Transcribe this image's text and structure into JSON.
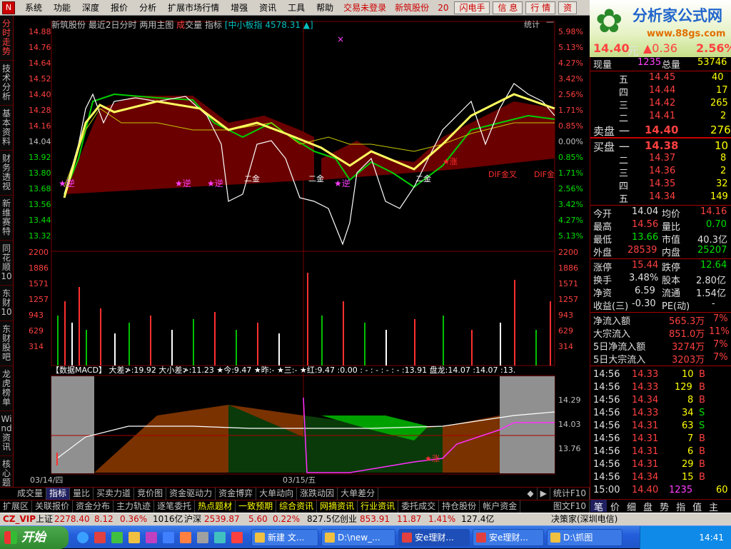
{
  "app": {
    "icon_label": "N"
  },
  "menu": {
    "items": [
      "系统",
      "功能",
      "深度",
      "报价",
      "分析",
      "扩展市场行情",
      "增强",
      "资讯",
      "工具",
      "帮助"
    ],
    "trade_not_logged": "交易未登录",
    "stock_link": "新筑股份",
    "year_fragment": "20",
    "buttons": [
      "闪电手",
      "信 息",
      "行 情",
      "资"
    ]
  },
  "logo": {
    "title": "分析家公式网",
    "url": "www.88gs.com"
  },
  "left_tabs": [
    "分时走势",
    "技术分析",
    "基本资料",
    "财务透视",
    "新维赛特",
    "同花顺10",
    "东财10",
    "东财股吧",
    "龙虎榜单",
    "Wind资讯",
    "核心题材"
  ],
  "chart_header": {
    "stock": "新筑股份",
    "period": "最近2日分时",
    "main": "两用主图",
    "vol_a": "成",
    "vol_b": "交量",
    "indicator": "指标",
    "index": "[中小板指 4578.31 ▲]",
    "stats_label": "统计",
    "minus": "—"
  },
  "price_axis": {
    "left": [
      "14.88",
      "14.76",
      "14.64",
      "14.52",
      "14.40",
      "14.28",
      "14.16",
      "14.04",
      "13.92",
      "13.80",
      "13.68",
      "13.56",
      "13.44",
      "13.32"
    ],
    "right": [
      "5.98%",
      "5.13%",
      "4.27%",
      "3.42%",
      "2.56%",
      "1.71%",
      "0.85%",
      "0.00%",
      "0.85%",
      "1.71%",
      "2.56%",
      "3.42%",
      "4.27%",
      "5.13%"
    ]
  },
  "vol_axis": {
    "values": [
      "2200",
      "1886",
      "1571",
      "1257",
      "943",
      "629",
      "314"
    ]
  },
  "lower_axis": {
    "values": [
      "14.29",
      "14.03",
      "13.76"
    ]
  },
  "chart_marks": {
    "nijun": "★逆",
    "ermjin": "二金",
    "dif_cross": "DIF金叉",
    "dif_gold": "DIF金",
    "zhang": "★涨",
    "star_x": "×"
  },
  "macd_header": {
    "name": "【数据MACD】",
    "items": [
      "大差≯:19.92",
      "大小差≯:11.23",
      "★今:9.47",
      "★昨:-",
      "★三:-",
      "★红:9.47",
      ":0.00",
      ": - : - : - : - :13.91",
      "盘龙:14.07",
      ":14.07",
      ":13."
    ]
  },
  "date_labels": [
    "03/14/四",
    "03/15/五"
  ],
  "bottom_tabs_1": [
    "成交量",
    "指标",
    "量比",
    "买卖力道",
    "竞价图",
    "资金驱动力",
    "资金博弈",
    "大单动向",
    "涨跌动因",
    "大单差分"
  ],
  "bottom_tabs_1_right": [
    "◆",
    "▶",
    "统计F10"
  ],
  "bottom_tabs_2": [
    "扩展区",
    "关联报价",
    "资金分布",
    "主力轨迹",
    "逐笔委托",
    "热点题材",
    "一致预期",
    "综合资讯",
    "网摘资讯",
    "行业资讯",
    "委托成交",
    "持仓股份",
    "帐户资金"
  ],
  "bottom_tabs_2_right": [
    "图文F10"
  ],
  "quote": {
    "price": "14.40",
    "unit": "元",
    "change": "▲0.36",
    "pct": "2.56%",
    "now_vol_label": "现量",
    "now_vol": "1235",
    "total_vol_label": "总量",
    "total_vol": "53746",
    "sell": [
      {
        "label": "五",
        "price": "14.45",
        "vol": "40"
      },
      {
        "label": "四",
        "price": "14.44",
        "vol": "17"
      },
      {
        "label": "三",
        "price": "14.42",
        "vol": "265"
      },
      {
        "label": "二",
        "price": "14.41",
        "vol": "2"
      },
      {
        "label": "一",
        "price": "14.40",
        "vol": "276"
      }
    ],
    "sell_label": "卖盘",
    "buy_label": "买盘",
    "buy": [
      {
        "label": "一",
        "price": "14.38",
        "vol": "10"
      },
      {
        "label": "二",
        "price": "14.37",
        "vol": "8"
      },
      {
        "label": "三",
        "price": "14.36",
        "vol": "2"
      },
      {
        "label": "四",
        "price": "14.35",
        "vol": "32"
      },
      {
        "label": "五",
        "price": "14.34",
        "vol": "149"
      }
    ],
    "stats": [
      {
        "l1": "今开",
        "v1": "14.04",
        "l2": "均价",
        "v2": "14.16"
      },
      {
        "l1": "最高",
        "v1": "14.56",
        "l2": "量比",
        "v2": "0.70"
      },
      {
        "l1": "最低",
        "v1": "13.66",
        "l2": "市值",
        "v2": "40.3亿"
      },
      {
        "l1": "外盘",
        "v1": "28539",
        "l2": "内盘",
        "v2": "25207"
      },
      {
        "l1": "涨停",
        "v1": "15.44",
        "l2": "跌停",
        "v2": "12.64"
      },
      {
        "l1": "换手",
        "v1": "3.48%",
        "l2": "股本",
        "v2": "2.80亿"
      },
      {
        "l1": "净资",
        "v1": "6.59",
        "l2": "流通",
        "v2": "1.54亿"
      },
      {
        "l1": "收益(三)",
        "v1": "-0.30",
        "l2": "PE(动)",
        "v2": "-"
      }
    ],
    "flows": [
      {
        "label": "净流入额",
        "value": "565.3万",
        "pct": "7%"
      },
      {
        "label": "大宗流入",
        "value": "851.0万",
        "pct": "11%"
      },
      {
        "label": "5日净流入额",
        "value": "3274万",
        "pct": "7%"
      },
      {
        "label": "5日大宗流入",
        "value": "3203万",
        "pct": "7%"
      }
    ],
    "ticks": [
      {
        "t": "14:56",
        "p": "14.33",
        "v": "10",
        "s": "B"
      },
      {
        "t": "14:56",
        "p": "14.33",
        "v": "129",
        "s": "B"
      },
      {
        "t": "14:56",
        "p": "14.34",
        "v": "8",
        "s": "B"
      },
      {
        "t": "14:56",
        "p": "14.33",
        "v": "34",
        "s": "S"
      },
      {
        "t": "14:56",
        "p": "14.31",
        "v": "63",
        "s": "S"
      },
      {
        "t": "14:56",
        "p": "14.31",
        "v": "7",
        "s": "B"
      },
      {
        "t": "14:56",
        "p": "14.31",
        "v": "6",
        "s": "B"
      },
      {
        "t": "14:56",
        "p": "14.31",
        "v": "29",
        "s": "B"
      },
      {
        "t": "14:56",
        "p": "14.34",
        "v": "15",
        "s": "B"
      },
      {
        "t": "15:00",
        "p": "14.40",
        "v": "1235",
        "s": "60"
      }
    ],
    "right_tabs": [
      "笔",
      "价",
      "细",
      "盘",
      "势",
      "指",
      "值",
      "主"
    ]
  },
  "status": {
    "prefix": "CZ_VIP",
    "sh_label": "上证",
    "sh": "2278.40",
    "sh_chg": "8.12",
    "sh_pct": "0.36%",
    "sh_amt": "1016亿",
    "sz_label": "沪深",
    "sz": "2539.87",
    "sz_chg": "5.60",
    "sz_pct": "0.22%",
    "sz_amt": "827.5亿",
    "cy_label": "创业",
    "cy": "853.91",
    "cy_chg": "11.87",
    "cy_pct": "1.41%",
    "cy_amt": "127.4亿",
    "server": "决策家(深圳电信)"
  },
  "taskbar": {
    "start": "开始",
    "tasks": [
      "新建 文...",
      "D:\\new_...",
      "安e理财...",
      "安e理财...",
      "D:\\抓图"
    ],
    "time": "14:41"
  }
}
